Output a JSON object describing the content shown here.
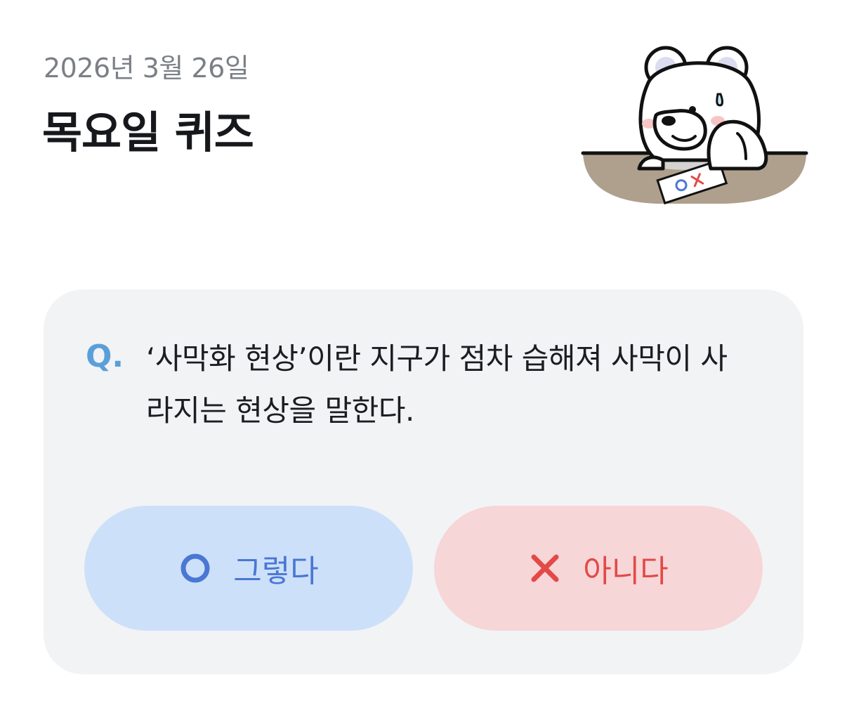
{
  "header": {
    "date": "2026년 3월 26일",
    "title": "목요일 퀴즈"
  },
  "mascot": {
    "icon": "polar-bear-thinking-illustration",
    "paper_text": "ox"
  },
  "quiz": {
    "q_label": "Q.",
    "question": "‘사막화 현상’이란 지구가 점차 습해져 사막이 사라지는 현상을 말한다."
  },
  "answers": {
    "yes_label": "그렇다",
    "yes_icon": "circle-o-icon",
    "no_label": "아니다",
    "no_icon": "x-mark-icon"
  },
  "colors": {
    "card_bg": "#f2f3f5",
    "q_accent": "#5a9fd9",
    "yes_bg": "#cde0f9",
    "yes_fg": "#4a77d3",
    "no_bg": "#f7d6d8",
    "no_fg": "#e24a48"
  }
}
